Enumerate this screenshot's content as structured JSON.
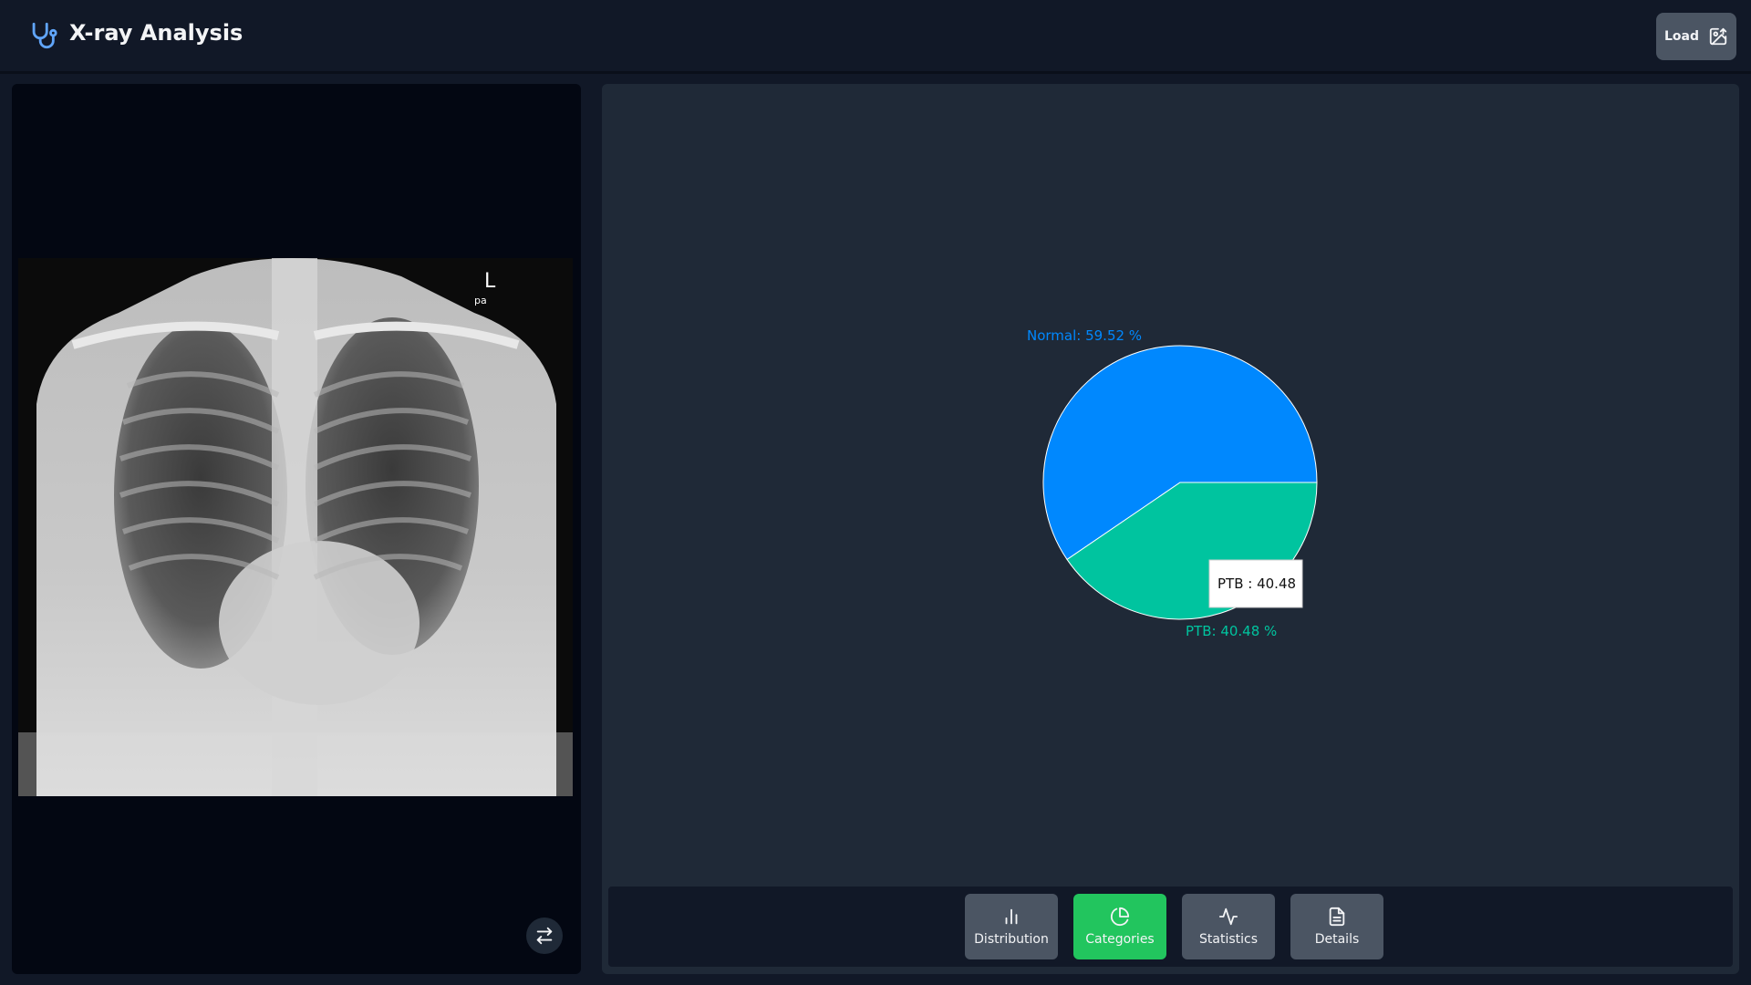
{
  "app": {
    "title": "X-ray Analysis",
    "load_label": "Load"
  },
  "xray": {
    "marker": "L",
    "view": "pa"
  },
  "tabs": [
    {
      "label": "Distribution",
      "icon": "bar-chart-icon",
      "active": false
    },
    {
      "label": "Categories",
      "icon": "pie-chart-icon",
      "active": true
    },
    {
      "label": "Statistics",
      "icon": "activity-icon",
      "active": false
    },
    {
      "label": "Details",
      "icon": "document-icon",
      "active": false
    }
  ],
  "tooltip": "PTB : 40.48",
  "chart_data": {
    "type": "pie",
    "slices": [
      {
        "name": "Normal",
        "value": 59.52,
        "label": "Normal: 59.52 %",
        "color": "#0088fe"
      },
      {
        "name": "PTB",
        "value": 40.48,
        "label": "PTB: 40.48 %",
        "color": "#00c49f"
      }
    ]
  },
  "colors": {
    "accent": "#22c55e",
    "normal": "#0088fe",
    "ptb": "#00c49f"
  }
}
